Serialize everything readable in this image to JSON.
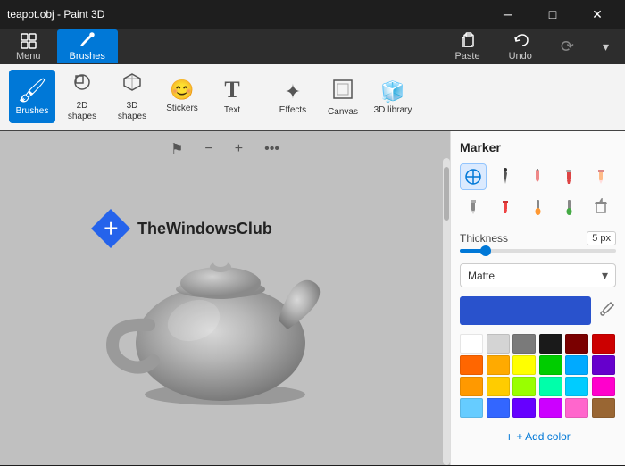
{
  "titleBar": {
    "title": "teapot.obj - Paint 3D",
    "minBtn": "─",
    "maxBtn": "□",
    "closeBtn": "✕"
  },
  "ribbonTabs": [
    {
      "id": "menu",
      "label": "Menu",
      "active": false
    },
    {
      "id": "brushes",
      "label": "Brushes",
      "active": true
    }
  ],
  "ribbonItems": [
    {
      "id": "brushes",
      "label": "Brushes",
      "active": true,
      "icon": "🖌"
    },
    {
      "id": "2dshapes",
      "label": "2D shapes",
      "active": false,
      "icon": "⬟"
    },
    {
      "id": "3dshapes",
      "label": "3D shapes",
      "active": false,
      "icon": "⬡"
    },
    {
      "id": "stickers",
      "label": "Stickers",
      "active": false,
      "icon": "😊"
    },
    {
      "id": "text",
      "label": "Text",
      "active": false,
      "icon": "T"
    },
    {
      "id": "effects",
      "label": "Effects",
      "active": false,
      "icon": "✦"
    },
    {
      "id": "canvas",
      "label": "Canvas",
      "active": false,
      "icon": "⬜"
    },
    {
      "id": "3dlibrary",
      "label": "3D library",
      "active": false,
      "icon": "🧊"
    }
  ],
  "canvasToolbar": {
    "flagIcon": "⚑",
    "minusIcon": "−",
    "plusIcon": "+",
    "moreIcon": "···"
  },
  "watermark": {
    "logo": "✕",
    "text": "TheWindowsClub"
  },
  "rightPanel": {
    "title": "Marker",
    "brushIcons": [
      {
        "id": "compass",
        "icon": "✏",
        "selected": true
      },
      {
        "id": "pen",
        "icon": "🖊"
      },
      {
        "id": "brush1",
        "icon": "🖌"
      },
      {
        "id": "marker",
        "icon": "✒"
      },
      {
        "id": "pencil",
        "icon": "✏"
      },
      {
        "id": "pencil2",
        "icon": "✏"
      },
      {
        "id": "crayon",
        "icon": "🖍"
      },
      {
        "id": "brush2",
        "icon": "🖌"
      },
      {
        "id": "pen2",
        "icon": "🖊"
      },
      {
        "id": "bucket",
        "icon": "🪣"
      }
    ],
    "thickness": {
      "label": "Thickness",
      "value": "5 px",
      "sliderPercent": 15
    },
    "material": {
      "label": "Matte",
      "chevron": "▾"
    },
    "selectedColor": "#2952cc",
    "colorRows": [
      [
        "#ffffff",
        "#d4d4d4",
        "#7a7a7a",
        "#1a1a1a",
        "#7a0000",
        "#cc0000"
      ],
      [
        "#ff6600",
        "#ffaa00",
        "#ffff00",
        "#00cc00",
        "#00aaff",
        "#6600cc"
      ],
      [
        "#ff9900",
        "#ffcc00",
        "#99ff00",
        "#00ffaa",
        "#00ccff",
        "#ff00cc"
      ],
      [
        "#66ccff",
        "#3366ff",
        "#6600ff",
        "#cc00ff",
        "#ff66cc",
        "#996633"
      ]
    ],
    "addColorLabel": "+ Add color"
  }
}
